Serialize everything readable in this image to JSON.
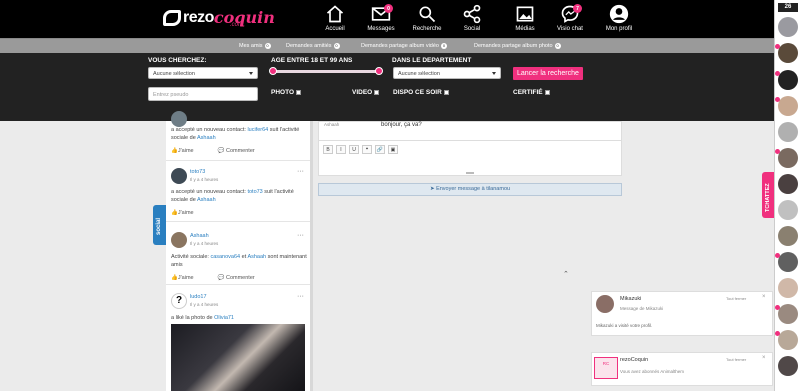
{
  "header": {
    "logo_text_1": "rezo",
    "logo_text_2": "coquin",
    "logo_sub": ".com",
    "nav": [
      {
        "label": "Accueil",
        "icon": "home-icon"
      },
      {
        "label": "Messages",
        "icon": "envelope-icon",
        "badge": "0"
      },
      {
        "label": "Recherche",
        "icon": "search-icon"
      },
      {
        "label": "Social",
        "icon": "share-icon"
      },
      {
        "label": "Médias",
        "icon": "image-icon"
      },
      {
        "label": "Visio chat",
        "icon": "messenger-icon",
        "badge": "7"
      },
      {
        "label": "Mon profil",
        "icon": "user-icon"
      }
    ]
  },
  "subnav": [
    {
      "label": "Mes amis",
      "count": "0"
    },
    {
      "label": "Demandes amitiés",
      "count": "0"
    },
    {
      "label": "Demandes partage album vidéo",
      "count": "0"
    },
    {
      "label": "Demandes partage album photo",
      "count": "0"
    }
  ],
  "search": {
    "vous_cherchez": "VOUS CHERCHEZ:",
    "age_label": "AGE ENTRE 18 ET 99 ANS",
    "dept_label": "DANS LE DEPARTEMENT",
    "select1": "Aucune sélection",
    "select2": "Aucune sélection",
    "pseudo_placeholder": "Entrez pseudo",
    "button": "Lancer la recherche",
    "photo": "PHOTO",
    "video": "VIDEO",
    "dispo": "DISPO CE SOIR",
    "certifie": "CERTIFIÉ",
    "age_min": 18,
    "age_max": 99
  },
  "feed": {
    "posts": [
      {
        "text_pre": "a accepté un nouveau contact: ",
        "link1": "lucifer64",
        "text_mid": " suit l'activité sociale de ",
        "link2": "Ashaah"
      },
      {
        "name": "toto73",
        "time": "Il y a 4 heures",
        "text_pre": "a accepté un nouveau contact: ",
        "link1": "toto73",
        "text_mid": " suit l'activité sociale de ",
        "link2": "Ashaah"
      },
      {
        "name": "Ashaah",
        "time": "Il y a 4 heures",
        "text_pre": "Activité sociale: ",
        "link1": "casanova64",
        "text_mid": " et ",
        "link2": "Ashaah",
        "text_post": " sont maintenant amis"
      },
      {
        "name": "ludo17",
        "time": "Il y a 4 heures",
        "text_pre": "a liké la photo de ",
        "link1": "Olivia71"
      }
    ],
    "like": "J'aime",
    "comment": "Commenter"
  },
  "social_tab": "social",
  "chat": {
    "sender": "Ashaah",
    "message": "bonjour, ça va?",
    "send_button": "Envoyer message à tilanamou",
    "tools": [
      "B",
      "I",
      "U",
      "❝",
      "🔗",
      "▣"
    ]
  },
  "notifications": [
    {
      "name": "Mikazuki",
      "close": "Tout fermer",
      "sub": "Message de Mikazuki",
      "line": "Mikazuki a visité votre profil."
    },
    {
      "name": "rezoCoquin",
      "close": "Tout fermer",
      "sub": "Vous avez abonnés Animalthem"
    }
  ],
  "sidebar": {
    "count": "26",
    "tchat_label": "TCHATTEZ"
  },
  "colors": {
    "accent": "#f0307e",
    "link": "#2a7fc0"
  }
}
